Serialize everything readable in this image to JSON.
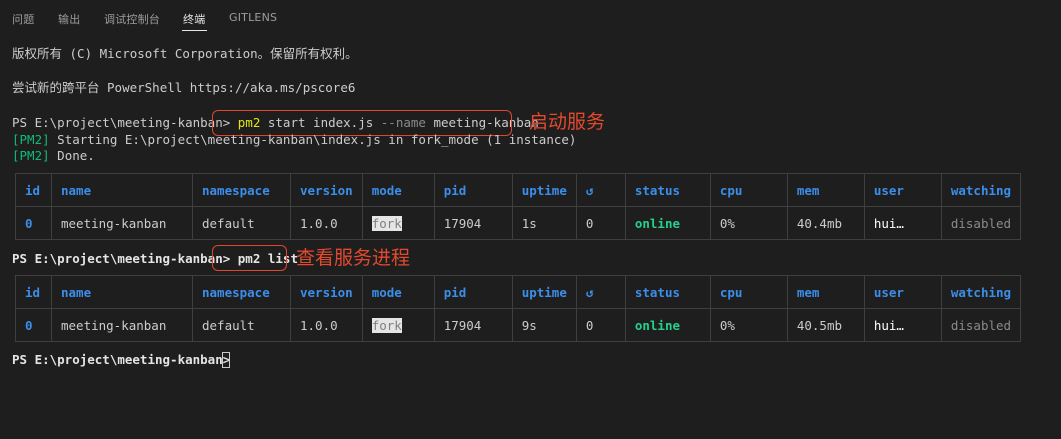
{
  "tabs": [
    {
      "label": "问题"
    },
    {
      "label": "输出"
    },
    {
      "label": "调试控制台"
    },
    {
      "label": "终端"
    },
    {
      "label": "GITLENS"
    }
  ],
  "terminal": {
    "copyright": "版权所有 (C) Microsoft Corporation。保留所有权利。",
    "try_ps": "尝试新的跨平台 PowerShell https://aka.ms/pscore6",
    "prompt1": "PS E:\\project\\meeting-kanban>",
    "cmd1_a": "pm2",
    "cmd1_b": " start index.js ",
    "cmd1_c": "--name",
    "cmd1_d": " meeting-kanban",
    "out1_tag": "[PM2]",
    "out1_text": " Starting E:\\project\\meeting-kanban\\index.js in fork_mode (1 instance)",
    "out2_tag": "[PM2]",
    "out2_text": " Done.",
    "prompt2": "PS E:\\project\\meeting-kanban>",
    "cmd2_a": "pm2",
    "cmd2_b": " list",
    "prompt3": "PS E:\\project\\meeting-kanban>"
  },
  "annotations": {
    "start_service": "启动服务",
    "view_process": "查看服务进程"
  },
  "table_headers": [
    "id",
    "name",
    "namespace",
    "version",
    "mode",
    "pid",
    "uptime",
    "↺",
    "status",
    "cpu",
    "mem",
    "user",
    "watching"
  ],
  "table1": {
    "id": "0",
    "name": "meeting-kanban",
    "namespace": "default",
    "version": "1.0.0",
    "mode": "fork",
    "pid": "17904",
    "uptime": "1s",
    "restarts": "0",
    "status": "online",
    "cpu": "0%",
    "mem": "40.4mb",
    "user": "hui…",
    "watching": "disabled"
  },
  "table2": {
    "id": "0",
    "name": "meeting-kanban",
    "namespace": "default",
    "version": "1.0.0",
    "mode": "fork",
    "pid": "17904",
    "uptime": "9s",
    "restarts": "0",
    "status": "online",
    "cpu": "0%",
    "mem": "40.5mb",
    "user": "hui…",
    "watching": "disabled"
  },
  "colors": {
    "background": "#1e1e1e",
    "annotation_red": "#e0472c",
    "pm2_green": "#23d18b",
    "header_blue": "#3b8eea",
    "command_yellow": "#e5e510"
  }
}
